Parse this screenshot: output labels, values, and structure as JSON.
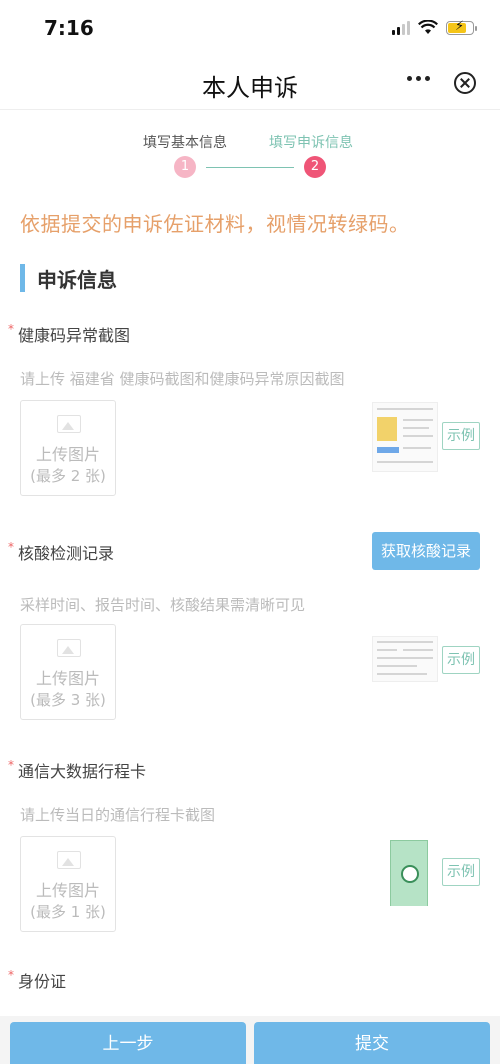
{
  "status": {
    "time": "7:16"
  },
  "nav": {
    "title": "本人申诉"
  },
  "steps": [
    {
      "label": "填写基本信息",
      "number": "1"
    },
    {
      "label": "填写申诉信息",
      "number": "2"
    }
  ],
  "notice": "依据提交的申诉佐证材料，视情况转绿码。",
  "section_title": "申诉信息",
  "required_mark": "*",
  "fields": [
    {
      "label": "健康码异常截图",
      "hint": "请上传 福建省 健康码截图和健康码异常原因截图",
      "upload_label": "上传图片",
      "upload_limit": "(最多 2 张)",
      "sample_label": "示例"
    },
    {
      "label": "核酸检测记录",
      "hint": "采样时间、报告时间、核酸结果需清晰可见",
      "upload_label": "上传图片",
      "upload_limit": "(最多 3 张)",
      "sample_label": "示例",
      "fetch_label": "获取核酸记录"
    },
    {
      "label": "通信大数据行程卡",
      "hint": "请上传当日的通信行程卡截图",
      "upload_label": "上传图片",
      "upload_limit": "(最多 1 张)",
      "sample_label": "示例"
    },
    {
      "label": "身份证"
    }
  ],
  "buttons": {
    "prev": "上一步",
    "submit": "提交"
  },
  "colors": {
    "accent": "#6fb8e8",
    "notice": "#e6a06a",
    "step_active": "#ef5577",
    "step_done": "#f6b5c5",
    "teal": "#7ec3b2"
  }
}
